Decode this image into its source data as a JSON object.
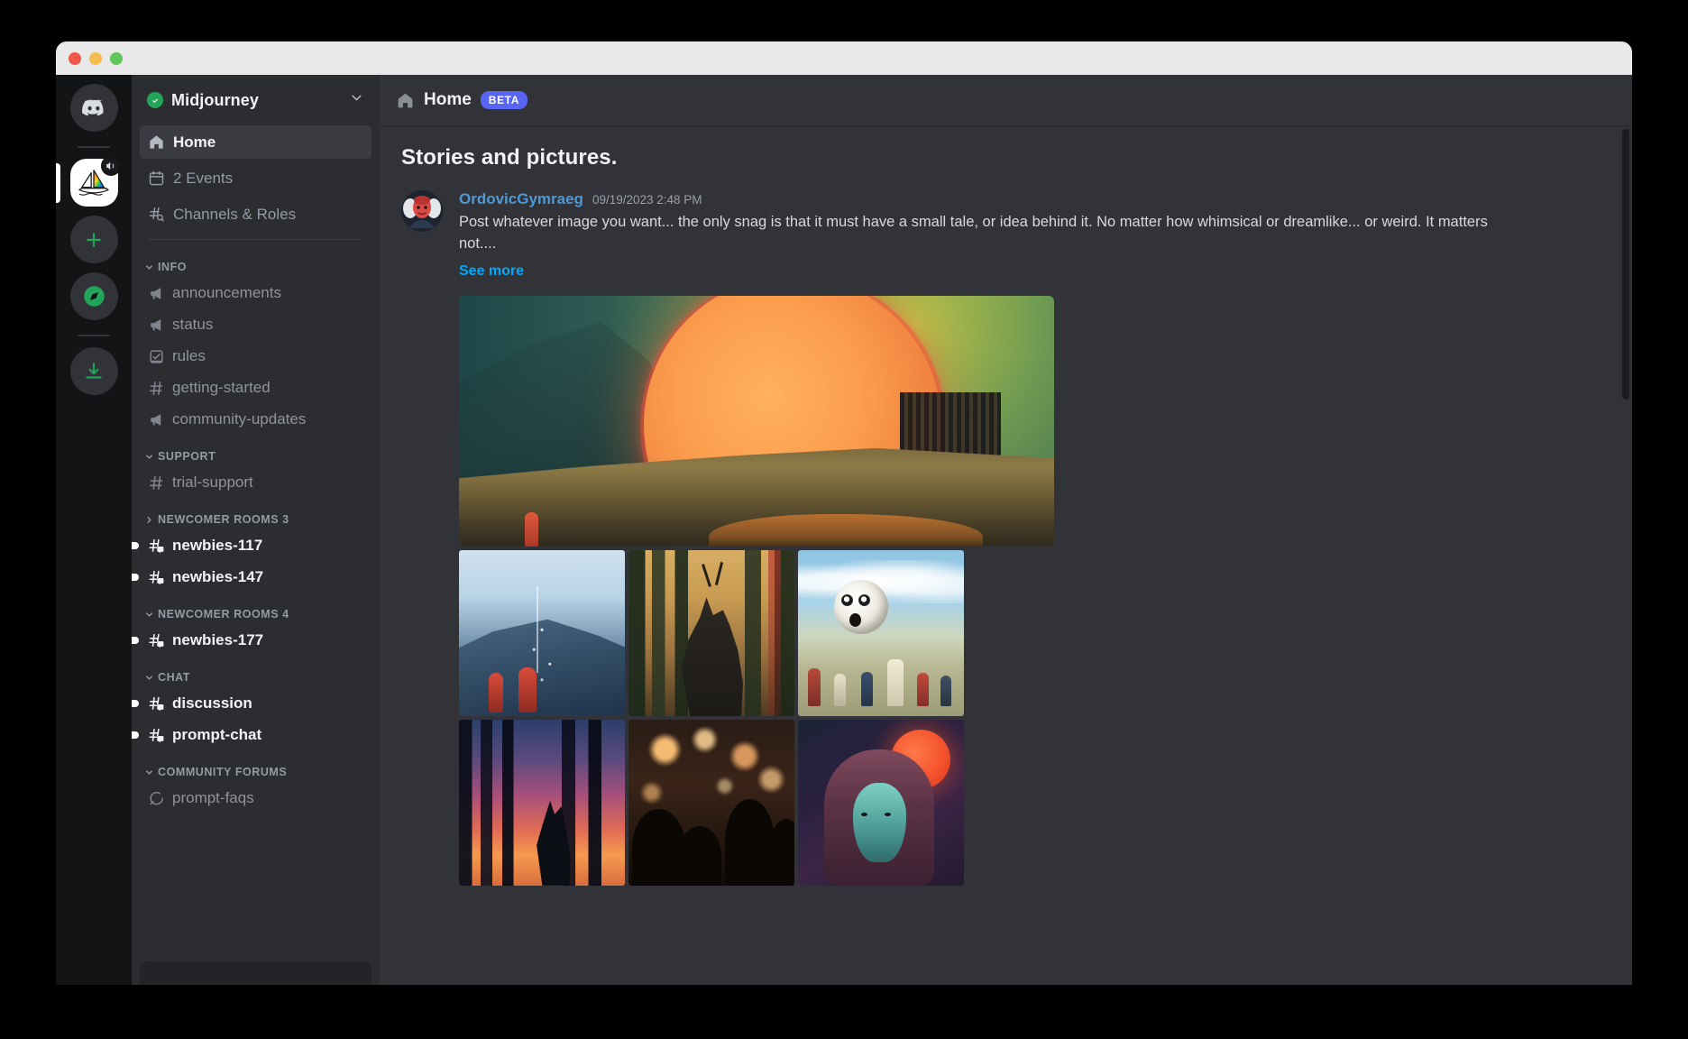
{
  "window": {
    "traffic_lights": [
      "close",
      "minimize",
      "maximize"
    ]
  },
  "server_rail": {
    "items": [
      {
        "name": "discord-home",
        "icon": "discord-logo-icon",
        "active": false
      },
      {
        "name": "midjourney-server",
        "icon": "sailboat-icon",
        "active": true,
        "muted": true
      },
      {
        "name": "add-server",
        "icon": "plus-icon",
        "active": false
      },
      {
        "name": "explore-servers",
        "icon": "compass-icon",
        "active": false
      },
      {
        "name": "download-apps",
        "icon": "download-icon",
        "active": false
      }
    ]
  },
  "sidebar": {
    "guild_name": "Midjourney",
    "guild_verified": true,
    "nav": [
      {
        "label": "Home",
        "icon": "home-icon",
        "selected": true
      },
      {
        "label": "2 Events",
        "icon": "calendar-icon",
        "selected": false
      },
      {
        "label": "Channels & Roles",
        "icon": "channels-roles-icon",
        "selected": false
      }
    ],
    "categories": [
      {
        "label": "INFO",
        "collapsed": false,
        "channels": [
          {
            "label": "announcements",
            "icon": "announcement-icon",
            "unread": false
          },
          {
            "label": "status",
            "icon": "announcement-icon",
            "unread": false
          },
          {
            "label": "rules",
            "icon": "rules-icon",
            "unread": false
          },
          {
            "label": "getting-started",
            "icon": "hash-icon",
            "unread": false
          },
          {
            "label": "community-updates",
            "icon": "announcement-icon",
            "unread": false
          }
        ]
      },
      {
        "label": "SUPPORT",
        "collapsed": false,
        "channels": [
          {
            "label": "trial-support",
            "icon": "hash-icon",
            "unread": false
          }
        ]
      },
      {
        "label": "NEWCOMER ROOMS 3",
        "collapsed": true,
        "channels": [
          {
            "label": "newbies-117",
            "icon": "hash-thread-icon",
            "unread": true
          },
          {
            "label": "newbies-147",
            "icon": "hash-thread-icon",
            "unread": true
          }
        ]
      },
      {
        "label": "NEWCOMER ROOMS 4",
        "collapsed": false,
        "channels": [
          {
            "label": "newbies-177",
            "icon": "hash-thread-icon",
            "unread": true
          }
        ]
      },
      {
        "label": "CHAT",
        "collapsed": false,
        "channels": [
          {
            "label": "discussion",
            "icon": "hash-thread-icon",
            "unread": true
          },
          {
            "label": "prompt-chat",
            "icon": "hash-thread-icon",
            "unread": true
          }
        ]
      },
      {
        "label": "COMMUNITY FORUMS",
        "collapsed": false,
        "channels": [
          {
            "label": "prompt-faqs",
            "icon": "forum-icon",
            "unread": false
          }
        ]
      }
    ]
  },
  "header": {
    "icon": "home-icon",
    "title": "Home",
    "badge": "BETA"
  },
  "main": {
    "page_heading": "Stories and pictures.",
    "post": {
      "author": "OrdovicGymraeg",
      "timestamp": "09/19/2023 2:48 PM",
      "text": "Post whatever image you want... the only snag is that it must have a small tale, or idea behind it. No matter how whimsical or dreamlike... or weird. It matters not....",
      "see_more": "See more",
      "avatar_alt": "red-masked-figure-avatar"
    },
    "gallery": [
      {
        "name": "hero-sun-valley",
        "alt": "giant orange sun over misty green valley with wooden tower"
      },
      {
        "name": "thumb-blue-mountain",
        "alt": "blue mountain with red robed figures"
      },
      {
        "name": "thumb-forest-beast",
        "alt": "dark horned beast among pine trees in amber light"
      },
      {
        "name": "thumb-eyeball-children",
        "alt": "eyeball ball and children running in a field"
      },
      {
        "name": "thumb-sunset-forest",
        "alt": "dark creature in sunset forest"
      },
      {
        "name": "thumb-bokeh-crowd",
        "alt": "night crowd with warm bokeh lights"
      },
      {
        "name": "thumb-portrait-redsun",
        "alt": "teal-faced portrait with red sun"
      }
    ]
  },
  "colors": {
    "accent_blurple": "#5865f2",
    "link_blue": "#00a8fc",
    "author_blue": "#4f9ad4",
    "verified_green": "#23a559",
    "app_bg": "#313338",
    "sidebar_bg": "#2b2d31",
    "rail_bg": "#131416"
  }
}
